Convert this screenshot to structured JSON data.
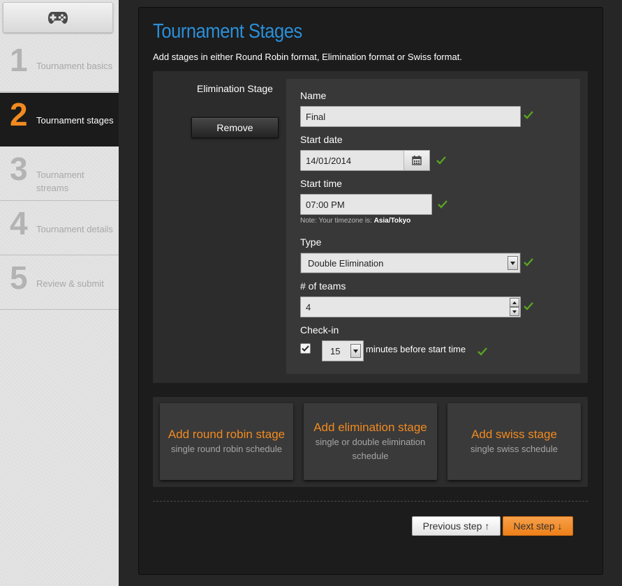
{
  "sidebar": {
    "logo_icon": "gamepad-icon",
    "steps": [
      {
        "number": "1",
        "label": "Tournament basics",
        "active": false
      },
      {
        "number": "2",
        "label": "Tournament stages",
        "active": true
      },
      {
        "number": "3",
        "label": "Tournament streams",
        "active": false
      },
      {
        "number": "4",
        "label": "Tournament details",
        "active": false
      },
      {
        "number": "5",
        "label": "Review & submit",
        "active": false
      }
    ]
  },
  "main": {
    "title": "Tournament Stages",
    "subtitle": "Add stages in either Round Robin format, Elimination format or Swiss format.",
    "stage": {
      "label": "Elimination Stage",
      "remove_label": "Remove",
      "name_label": "Name",
      "name_value": "Final",
      "start_date_label": "Start date",
      "start_date_value": "14/01/2014",
      "calendar_icon": "calendar-icon",
      "start_time_label": "Start time",
      "start_time_value": "07:00 PM",
      "timezone_note": "Note: Your timezone is:",
      "timezone_value": "Asia/Tokyo",
      "type_label": "Type",
      "type_value": "Double Elimination",
      "teams_label": "# of teams",
      "teams_value": "4",
      "checkin_label": "Check-in",
      "checkin_checked": true,
      "checkin_minutes": "15",
      "checkin_text": "minutes before start time"
    },
    "add_stages": [
      {
        "title": "Add round robin stage",
        "subtitle": "single round robin schedule"
      },
      {
        "title": "Add elimination stage",
        "subtitle": "single or double elimination schedule"
      },
      {
        "title": "Add swiss stage",
        "subtitle": "single swiss schedule"
      }
    ],
    "buttons": {
      "previous": "Previous step ↑",
      "next": "Next step ↓"
    }
  },
  "colors": {
    "accent_blue": "#2a8fd8",
    "accent_orange": "#f18a20",
    "valid_green": "#5aa321"
  }
}
